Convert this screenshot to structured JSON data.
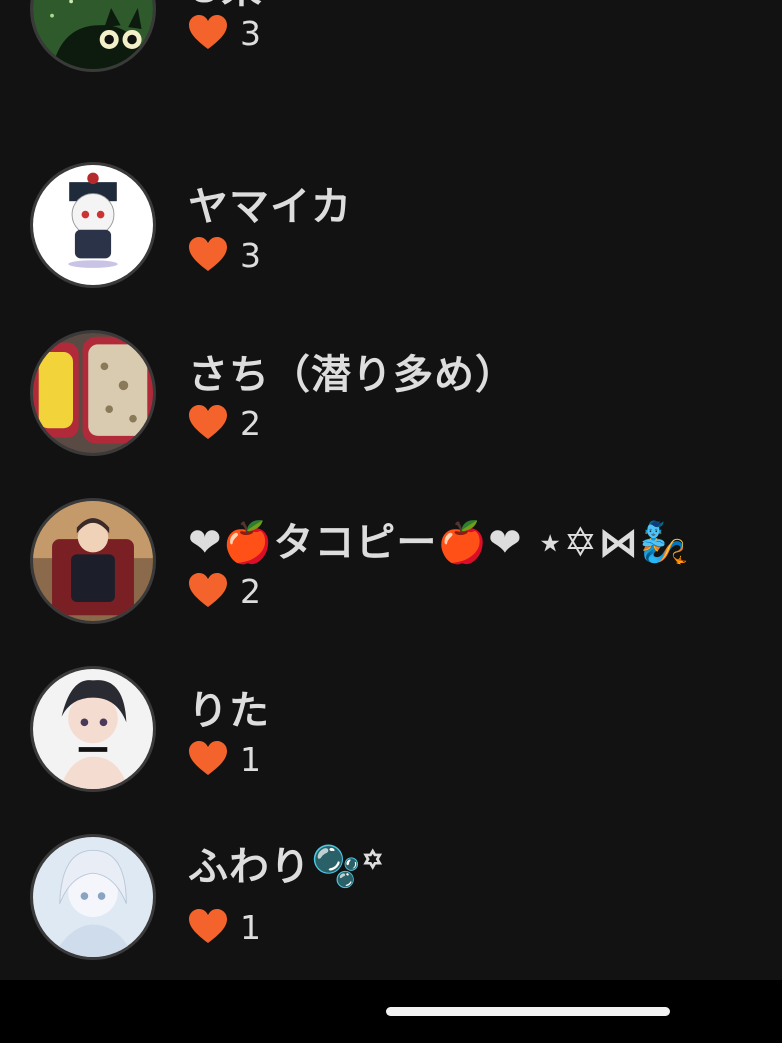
{
  "users": [
    {
      "name": "U来",
      "likes": "3",
      "avatar_icon": "green-cat-avatar-icon"
    },
    {
      "name": "ヤマイカ",
      "likes": "3",
      "avatar_icon": "chibi-ghost-avatar-icon"
    },
    {
      "name": "さち（潜り多め）",
      "likes": "2",
      "avatar_icon": "bento-avatar-icon"
    },
    {
      "name": "❤🍎タコピー🍎❤ ⋆✡⋈🧞",
      "likes": "2",
      "avatar_icon": "anime-boy-avatar-icon"
    },
    {
      "name": "りた",
      "likes": "1",
      "avatar_icon": "anime-dark-hair-avatar-icon"
    },
    {
      "name": "ふわり🫧꙳",
      "likes": "1",
      "avatar_icon": "anime-white-hair-avatar-icon"
    }
  ],
  "colors": {
    "background": "#121212",
    "heart": "#f4632b",
    "text": "#dddddd"
  }
}
